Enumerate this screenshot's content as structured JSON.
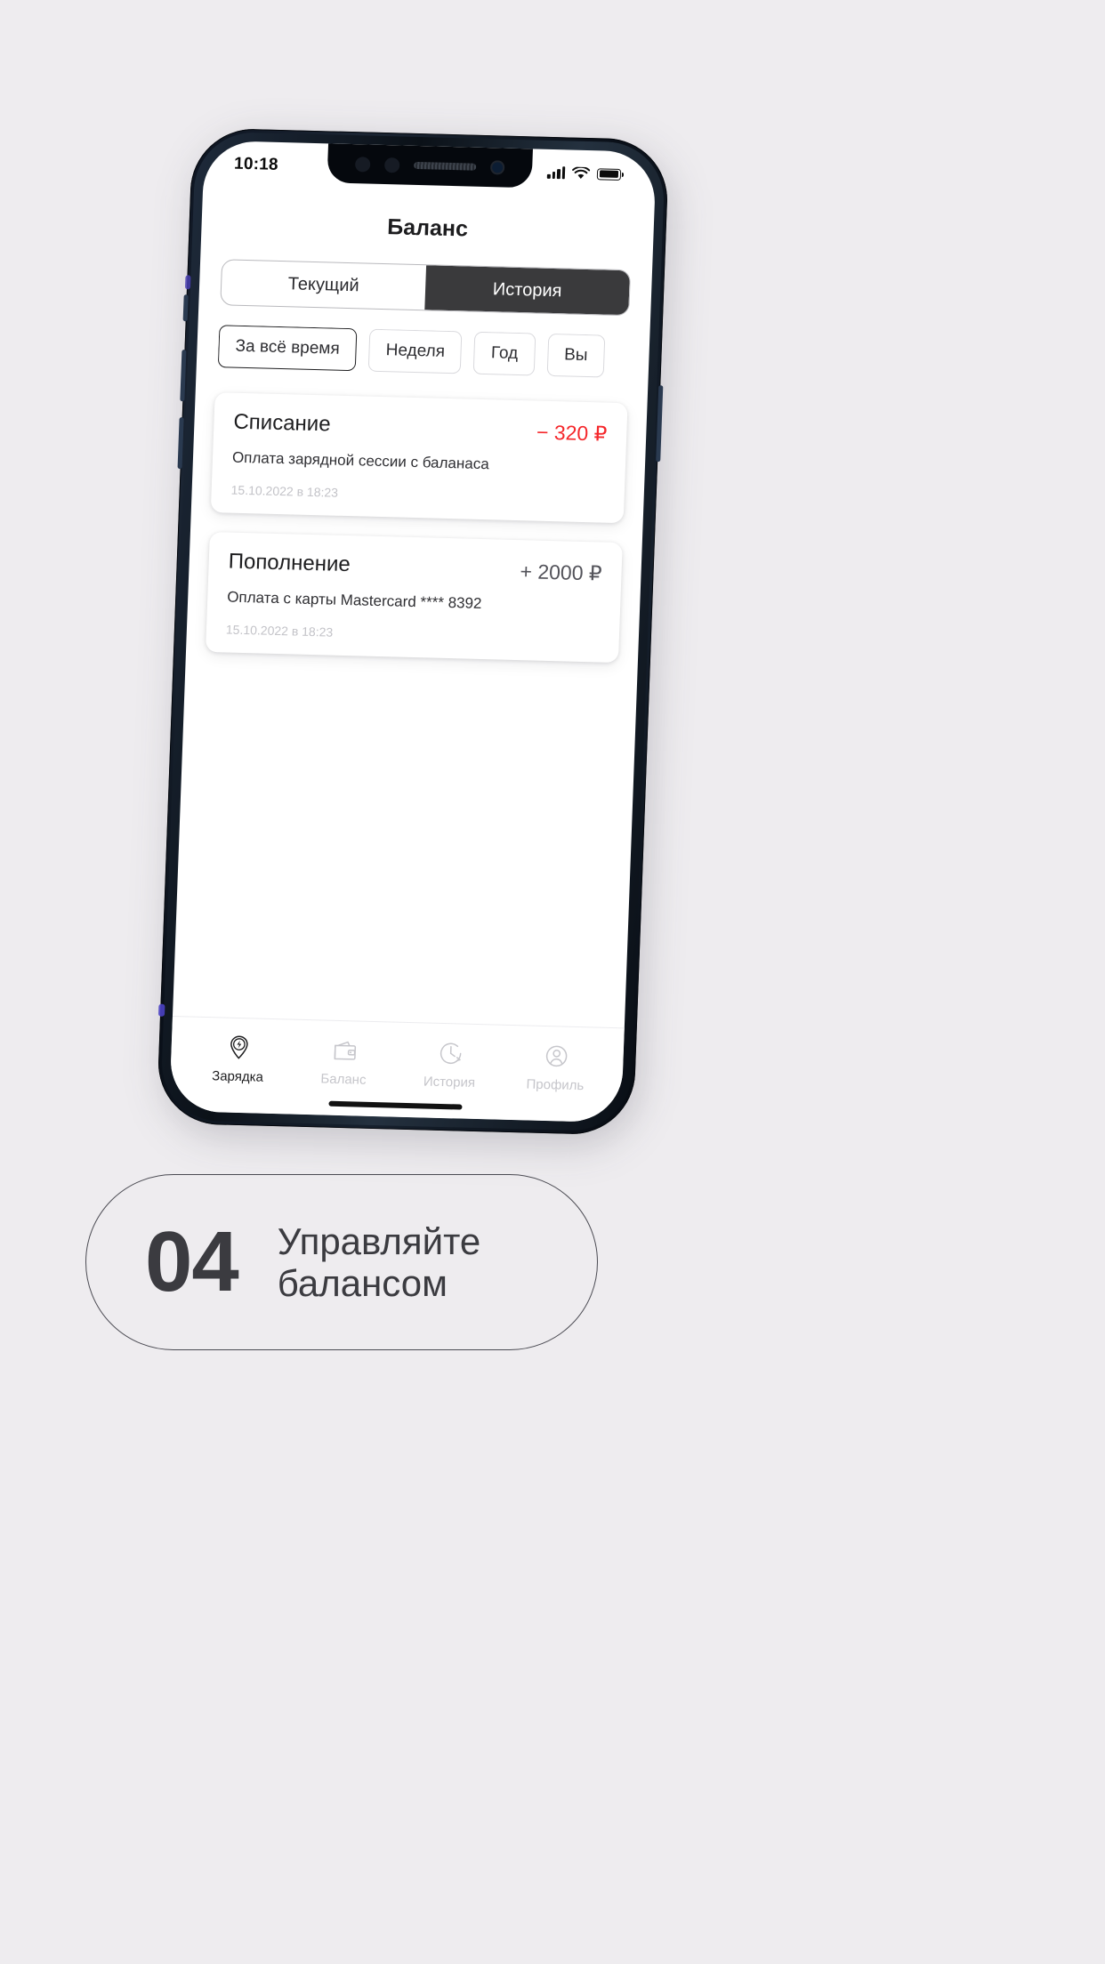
{
  "background_color": "#EEECEF",
  "phone": {
    "status_bar": {
      "time": "10:18",
      "icons": [
        "signal-icon",
        "wifi-icon",
        "battery-icon"
      ]
    },
    "app": {
      "title": "Баланс",
      "segmented_control": {
        "options": [
          {
            "label": "Текущий",
            "selected": false
          },
          {
            "label": "История",
            "selected": true
          }
        ]
      },
      "filters": [
        {
          "label": "За всё время",
          "selected": true
        },
        {
          "label": "Неделя",
          "selected": false
        },
        {
          "label": "Год",
          "selected": false
        },
        {
          "label": "Вы",
          "selected": false
        }
      ],
      "transactions": [
        {
          "title": "Списание",
          "amount": "− 320 ₽",
          "kind": "debit",
          "description": "Оплата зарядной сессии с баланаса",
          "date": "15.10.2022 в 18:23"
        },
        {
          "title": "Пополнение",
          "amount": "+ 2000 ₽",
          "kind": "credit",
          "description": "Оплата с карты Mastercard **** 8392",
          "date": "15.10.2022 в 18:23"
        }
      ],
      "tabbar": [
        {
          "label": "Зарядка",
          "icon": "charge-pin-icon",
          "active": true
        },
        {
          "label": "Баланс",
          "icon": "wallet-icon",
          "active": false
        },
        {
          "label": "История",
          "icon": "clock-history-icon",
          "active": false
        },
        {
          "label": "Профиль",
          "icon": "person-icon",
          "active": false
        }
      ]
    }
  },
  "caption": {
    "number": "04",
    "line1": "Управляйте",
    "line2": "балансом"
  },
  "colors": {
    "debit": "#F5272B",
    "credit": "#53535A",
    "segment_active_bg": "#3A3A3C",
    "text_primary": "#1D1D1F",
    "text_muted": "#C3C3C8"
  }
}
